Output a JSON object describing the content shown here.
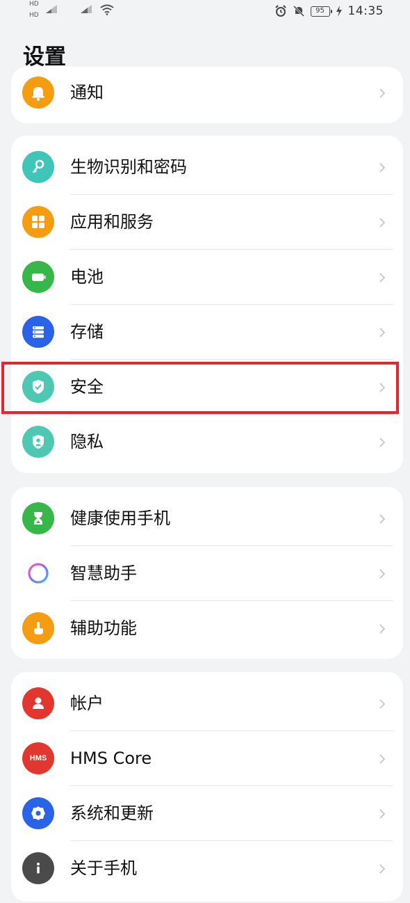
{
  "status_bar": {
    "sim1": "HD",
    "sim2": "HD",
    "battery": "95",
    "time": "14:35",
    "icons": [
      "alarm-icon",
      "mute-icon",
      "battery-icon",
      "charging-icon"
    ]
  },
  "page_title": "设置",
  "groups": [
    {
      "items": [
        {
          "label": "通知",
          "icon": "bell-icon",
          "color": "#f59d12"
        }
      ]
    },
    {
      "items": [
        {
          "label": "生物识别和密码",
          "icon": "key-icon",
          "color": "#3fc6b8"
        },
        {
          "label": "应用和服务",
          "icon": "apps-grid-icon",
          "color": "#f59d12"
        },
        {
          "label": "电池",
          "icon": "battery-icon",
          "color": "#37b64a"
        },
        {
          "label": "存储",
          "icon": "storage-icon",
          "color": "#2a62e8"
        },
        {
          "label": "安全",
          "icon": "shield-check-icon",
          "color": "#4fc8b3"
        },
        {
          "label": "隐私",
          "icon": "privacy-shield-icon",
          "color": "#4fc8b3"
        }
      ]
    },
    {
      "items": [
        {
          "label": "健康使用手机",
          "icon": "hourglass-icon",
          "color": "#37b64a"
        },
        {
          "label": "智慧助手",
          "icon": "assistant-ring-icon",
          "color": "#7b6cf0"
        },
        {
          "label": "辅助功能",
          "icon": "hand-icon",
          "color": "#f59d12"
        }
      ]
    },
    {
      "items": [
        {
          "label": "帐户",
          "icon": "user-icon",
          "color": "#e2372f"
        },
        {
          "label": "HMS Core",
          "icon": "hms-icon",
          "color": "#e2372f",
          "icon_text": "HMS"
        },
        {
          "label": "系统和更新",
          "icon": "gear-icon",
          "color": "#2a62e8"
        },
        {
          "label": "关于手机",
          "icon": "info-icon",
          "color": "#4a4a4a"
        }
      ]
    }
  ],
  "highlight": {
    "target": "安全",
    "color": "#e3262b"
  }
}
